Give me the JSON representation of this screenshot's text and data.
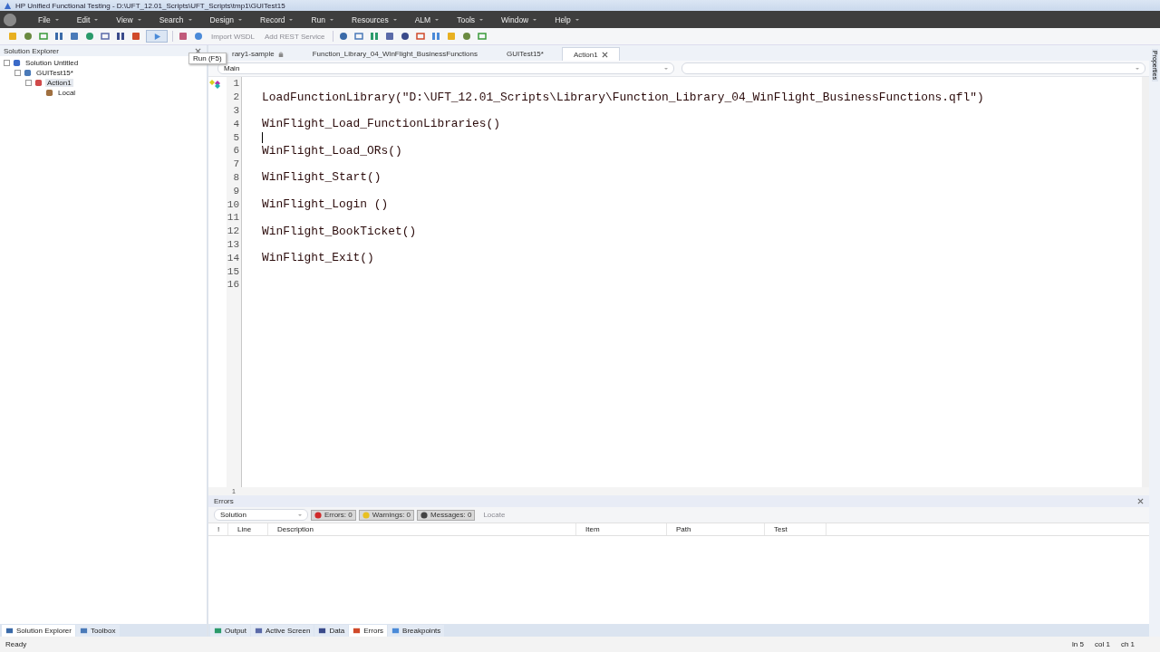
{
  "window": {
    "title": "HP Unified Functional Testing - D:\\UFT_12.01_Scripts\\UFT_Scripts\\tmp1\\GUITest15"
  },
  "menu": [
    "File",
    "Edit",
    "View",
    "Search",
    "Design",
    "Record",
    "Run",
    "Resources",
    "ALM",
    "Tools",
    "Window",
    "Help"
  ],
  "toolbar": {
    "buttons": [
      {
        "label": "Import WSDL",
        "disabled": true
      },
      {
        "label": "Add REST Service",
        "disabled": true
      }
    ]
  },
  "tooltip": "Run (F5)",
  "solution_explorer": {
    "title": "Solution Explorer",
    "tree": [
      {
        "label": "Solution Untitled",
        "kind": "solution",
        "expanded": true,
        "selected": false,
        "children": [
          {
            "label": "GUITest15*",
            "kind": "test",
            "expanded": true,
            "selected": false,
            "children": [
              {
                "label": "Action1",
                "kind": "action",
                "expanded": true,
                "selected": true,
                "children": [
                  {
                    "label": "Local",
                    "kind": "repository",
                    "expanded": false,
                    "selected": false
                  }
                ]
              }
            ]
          }
        ]
      }
    ]
  },
  "editor_tabs": [
    {
      "label": "rary1-sample",
      "locked": true,
      "selected": false
    },
    {
      "label": "Function_Library_04_WinFlight_BusinessFunctions",
      "locked": false,
      "selected": false
    },
    {
      "label": "GUITest15*",
      "locked": false,
      "selected": false
    },
    {
      "label": "Action1",
      "locked": false,
      "selected": true
    }
  ],
  "scope": {
    "value": "Main"
  },
  "editor": {
    "lines": [
      {
        "number": "1",
        "caret": false
      },
      {
        "number": "2",
        "code": "LoadFunctionLibrary(\"D:\\UFT_12.01_Scripts\\Library\\Function_Library_04_WinFlight_BusinessFunctions.qfl\")",
        "caret": false
      },
      {
        "number": "3",
        "caret": false
      },
      {
        "number": "4",
        "code": "WinFlight_Load_FunctionLibraries()",
        "caret": false
      },
      {
        "number": "5",
        "caret": true
      },
      {
        "number": "6",
        "code": "WinFlight_Load_ORs()",
        "caret": false
      },
      {
        "number": "7",
        "caret": false
      },
      {
        "number": "8",
        "code": "WinFlight_Start()",
        "caret": false
      },
      {
        "number": "9",
        "caret": false
      },
      {
        "number": "10",
        "code": "WinFlight_Login ()",
        "caret": false
      },
      {
        "number": "11",
        "caret": false
      },
      {
        "number": "12",
        "code": "WinFlight_BookTicket()",
        "caret": false
      },
      {
        "number": "13",
        "caret": false
      },
      {
        "number": "14",
        "code": "WinFlight_Exit()",
        "caret": false
      },
      {
        "number": "15",
        "caret": false
      },
      {
        "number": "16",
        "caret": false
      }
    ],
    "h_scroll_label": "1"
  },
  "errors_panel": {
    "title": "Errors",
    "scope": "Solution",
    "filters": [
      {
        "label": "Errors: 0",
        "kind": "error",
        "selected": true
      },
      {
        "label": "Warnings: 0",
        "kind": "warning",
        "selected": true
      },
      {
        "label": "Messages: 0",
        "kind": "info",
        "selected": true
      }
    ],
    "locate": {
      "label": "Locate",
      "disabled": true
    },
    "columns": [
      "!",
      "Line",
      "Description",
      "Item",
      "Path",
      "Test"
    ]
  },
  "properties_tab": "Properties",
  "left_tabs": [
    {
      "label": "Solution Explorer",
      "selected": true
    },
    {
      "label": "Toolbox",
      "selected": false
    }
  ],
  "bottom_tabs": [
    {
      "label": "Output",
      "selected": false
    },
    {
      "label": "Active Screen",
      "selected": false
    },
    {
      "label": "Data",
      "selected": false
    },
    {
      "label": "Errors",
      "selected": true
    },
    {
      "label": "Breakpoints",
      "selected": false
    }
  ],
  "status_bar": {
    "text": "Ready",
    "line": "ln 5",
    "column": "col 1",
    "char": "ch 1"
  }
}
